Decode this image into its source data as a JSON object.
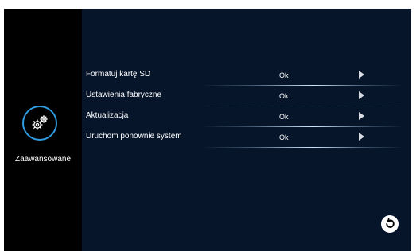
{
  "sidebar": {
    "category": {
      "label": "Zaawansowane",
      "icon": "gears-icon",
      "accent": "#2f9be0"
    }
  },
  "menu": {
    "items": [
      {
        "label": "Formatuj kartę SD",
        "value": "Ok",
        "icon": "play-arrow-icon"
      },
      {
        "label": "Ustawienia fabryczne",
        "value": "Ok",
        "icon": "play-arrow-icon"
      },
      {
        "label": "Aktualizacja",
        "value": "Ok",
        "icon": "play-arrow-icon"
      },
      {
        "label": "Uruchom ponownie system",
        "value": "Ok",
        "icon": "play-arrow-icon"
      }
    ]
  },
  "footer": {
    "back_icon": "back-arrow-icon"
  },
  "colors": {
    "screen_bg": "#07152b",
    "sidebar_bg": "#000000",
    "text": "#ffffff"
  }
}
